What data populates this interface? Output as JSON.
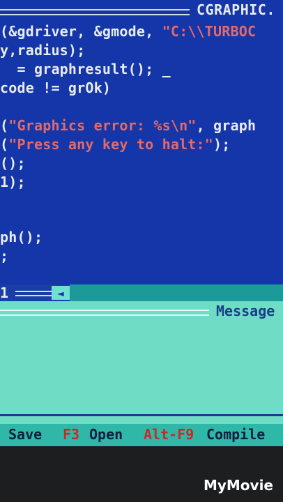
{
  "editor": {
    "filename": "CGRAPHIC.",
    "lines": [
      {
        "pre": "(&gdriver, &gmode, ",
        "str": "\"C:\\\\TURBOC",
        "post": ""
      },
      {
        "pre": "y,radius);",
        "str": "",
        "post": ""
      },
      {
        "pre": "  = graphresult(); ",
        "str": "",
        "post": "",
        "cursor": "_"
      },
      {
        "pre": "code != grOk)",
        "str": "",
        "post": ""
      },
      {
        "pre": "",
        "str": "",
        "post": ""
      },
      {
        "pre": "(",
        "str": "\"Graphics error: %s\\n\"",
        "post": ", graph"
      },
      {
        "pre": "(",
        "str": "\"Press any key to halt:\"",
        "post": ");"
      },
      {
        "pre": "();",
        "str": "",
        "post": ""
      },
      {
        "pre": "1);",
        "str": "",
        "post": ""
      },
      {
        "pre": "",
        "str": "",
        "post": ""
      },
      {
        "pre": "",
        "str": "",
        "post": ""
      },
      {
        "pre": "ph();",
        "str": "",
        "post": ""
      },
      {
        "pre": ";",
        "str": "",
        "post": ""
      }
    ],
    "window_number": "1"
  },
  "message": {
    "title": "Message"
  },
  "status_bar": {
    "items": [
      {
        "key": "",
        "label": "Save"
      },
      {
        "key": "F3",
        "label": "Open"
      },
      {
        "key": "Alt-F9",
        "label": "Compile"
      }
    ]
  },
  "watermark": "MyMovie"
}
